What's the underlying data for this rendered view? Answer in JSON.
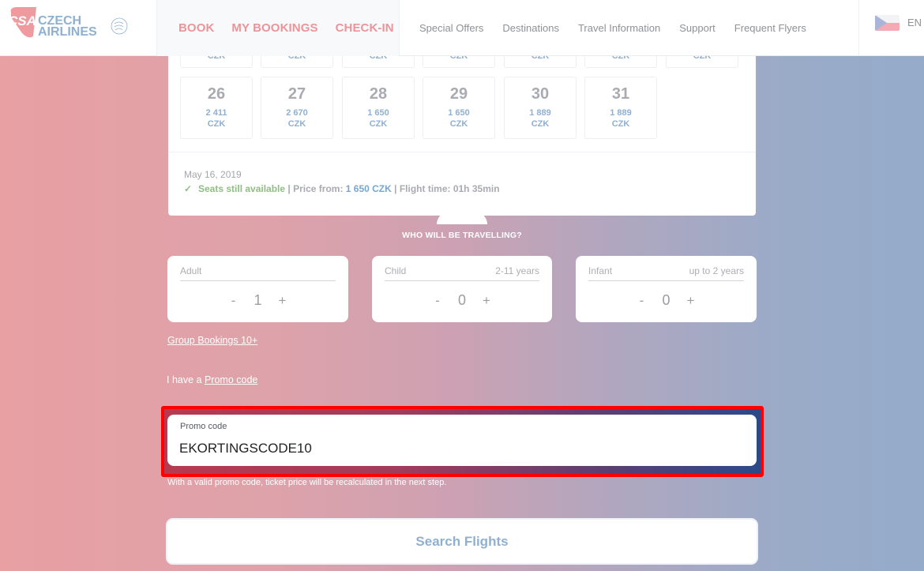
{
  "header": {
    "logo": {
      "mark": "CSA",
      "line1": "CZECH",
      "line2": "AIRLINES",
      "alliance": "SKYTEAM"
    },
    "primary_nav": [
      "BOOK",
      "MY BOOKINGS",
      "CHECK-IN"
    ],
    "secondary_nav": [
      "Special Offers",
      "Destinations",
      "Travel Information",
      "Support",
      "Frequent Flyers"
    ],
    "language": {
      "code": "EN",
      "flag_icon": "czech-flag-icon"
    }
  },
  "calendar": {
    "prev_row_currency": [
      "CZK",
      "CZK",
      "CZK",
      "CZK",
      "CZK",
      "CZK",
      "CZK"
    ],
    "days": [
      {
        "day": "26",
        "price": "2 411",
        "currency": "CZK"
      },
      {
        "day": "27",
        "price": "2 670",
        "currency": "CZK"
      },
      {
        "day": "28",
        "price": "1 650",
        "currency": "CZK"
      },
      {
        "day": "29",
        "price": "1 650",
        "currency": "CZK"
      },
      {
        "day": "30",
        "price": "1 889",
        "currency": "CZK"
      },
      {
        "day": "31",
        "price": "1 889",
        "currency": "CZK"
      }
    ],
    "selected": {
      "date": "May 16, 2019",
      "availability": "Seats still available",
      "sep1": " | Price from: ",
      "price": "1 650 CZK",
      "sep2": " | Flight time: 01h 35min"
    }
  },
  "passengers": {
    "title": "WHO WILL BE TRAVELLING?",
    "types": [
      {
        "label": "Adult",
        "age": "",
        "count": "1"
      },
      {
        "label": "Child",
        "age": "2-11 years",
        "count": "0"
      },
      {
        "label": "Infant",
        "age": "up to 2 years",
        "count": "0"
      }
    ],
    "minus": "-",
    "plus": "+"
  },
  "group_bookings": "Group Bookings 10+",
  "promo": {
    "prefix": "I have a ",
    "link": "Promo code",
    "field_label": "Promo code",
    "value": "EKORTINGSCODE10",
    "hint": "With a valid promo code, ticket price will be recalculated in the next step."
  },
  "search_button": "Search Flights",
  "colors": {
    "brand_pink": "#ec9499",
    "brand_blue": "#8fb0d0",
    "available_green": "#8fbd83",
    "highlight_red": "#ff0000"
  }
}
